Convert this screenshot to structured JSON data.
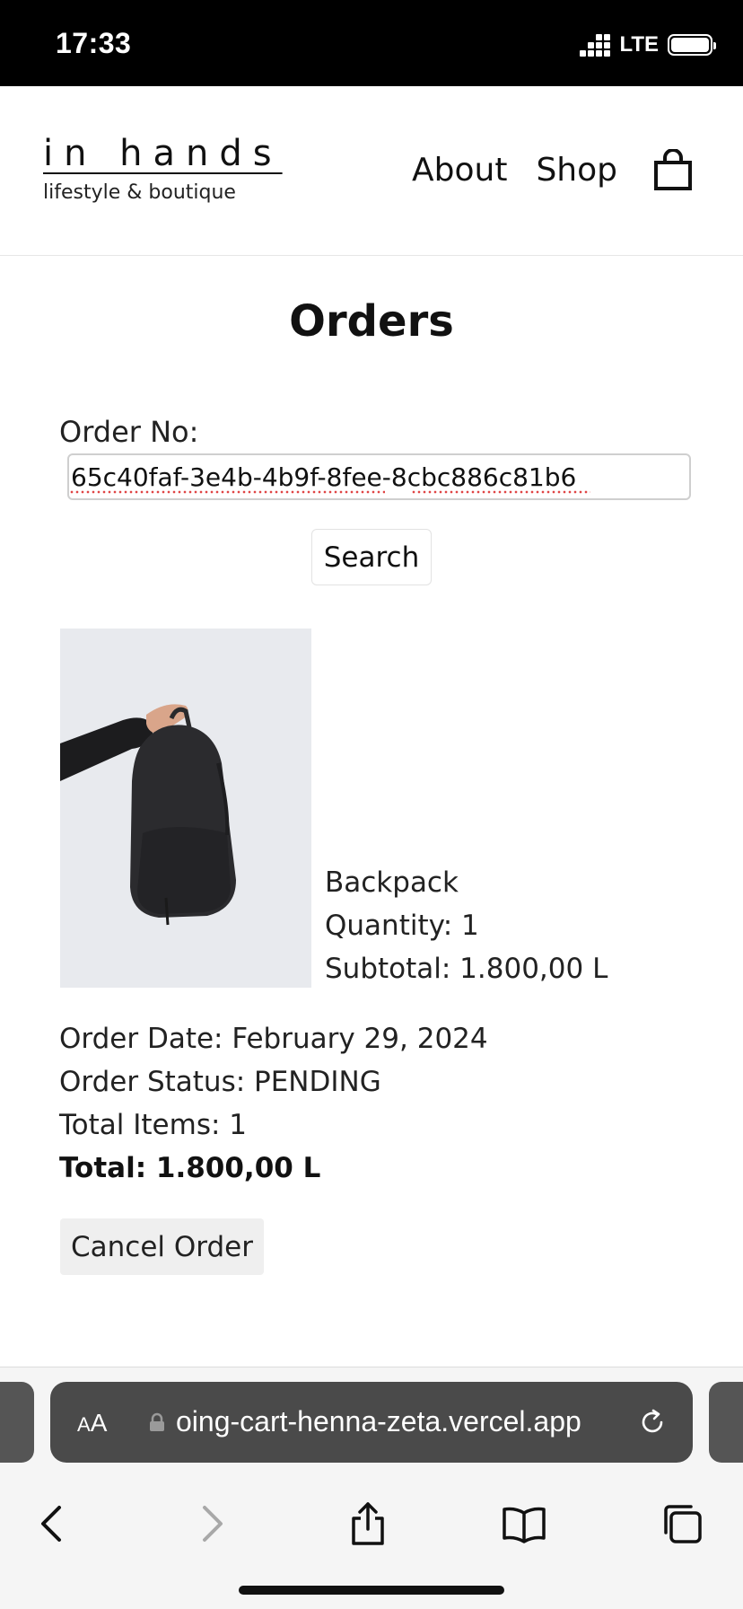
{
  "status_bar": {
    "time": "17:33",
    "network": "LTE"
  },
  "header": {
    "logo_title": "in hands",
    "logo_subtitle": "lifestyle & boutique",
    "nav": {
      "about": "About",
      "shop": "Shop"
    }
  },
  "page": {
    "title": "Orders",
    "order_label": "Order No:",
    "order_value": "65c40faf-3e4b-4b9f-8fee-8cbc886c81b6",
    "search_label": "Search"
  },
  "product": {
    "name": "Backpack",
    "quantity": "Quantity: 1",
    "subtotal": "Subtotal: 1.800,00 L"
  },
  "summary": {
    "date": "Order Date: February 29, 2024",
    "status": "Order Status: PENDING",
    "items": "Total Items: 1",
    "total": "Total: 1.800,00 L"
  },
  "cancel_label": "Cancel Order",
  "browser": {
    "aa_small": "A",
    "aa_large": "A",
    "url": "oing-cart-henna-zeta.vercel.app"
  },
  "colors": {
    "status_bar": "#000000",
    "text": "#111111",
    "url_pill": "#4a4a4a",
    "spellcheck": "#e04444"
  }
}
